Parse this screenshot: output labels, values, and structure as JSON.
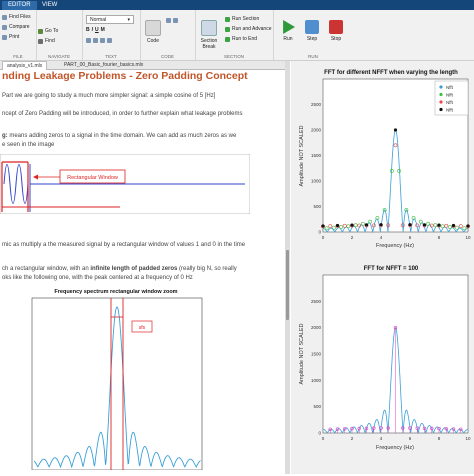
{
  "tabs": [
    "EDITOR",
    "VIEW"
  ],
  "ribbon": {
    "file_group": {
      "items": [
        "Find Files",
        "Compare",
        "Print"
      ],
      "label": "FILE"
    },
    "navigate_group": {
      "items": [
        "Go To",
        "Find"
      ],
      "label": "NAVIGATE"
    },
    "text_group": {
      "font": "Normal",
      "label": "TEXT"
    },
    "code_group": {
      "label": "CODE",
      "code_label": "Code"
    },
    "section_group": {
      "items": [
        "Section Break",
        "Run Section",
        "Run and Advance",
        "Run to End"
      ],
      "label": "SECTION"
    },
    "run_group": {
      "items": [
        "Run",
        "Step",
        "Stop"
      ],
      "label": "RUN"
    }
  },
  "doc_tabs": [
    "analysis_v1.mlx",
    "PART_00_Basic_fourier_basics.mlx"
  ],
  "document": {
    "title": "nding Leakage Problems - Zero Padding Concept",
    "lines": [
      "Part we are going to study a much more simpler signal: a simple cosine of 5 [Hz]",
      "ncept of Zero Padding will be introduced, in order to further explain what leakage problems"
    ],
    "zp_prefix": "g:",
    "zp_rest": "means adding zeros to a signal in the time domain. We can add as much zeros as we",
    "zp_line2": "e seen in the image",
    "rect_window_label": "Rectangular Window",
    "line3": "mic as multiply a the measured signal by a rectangular window of values 1 and 0 in the time",
    "line4a": "ch a rectangular window, with an ",
    "line4b": "infinite length of padded zeros",
    "line4c": " (really big N, so really",
    "line5": "oks like the following one, with the peak centered at a frequency of 0 Hz",
    "spectrum_title": "Frequency spectrum rectangular window zoom",
    "spectrum_annotation": "sfs"
  },
  "chart_data": [
    {
      "type": "line",
      "title": "FFT for different NFFT when varying the length",
      "xlabel": "Frequency (Hz)",
      "ylabel": "Amplitude NOT SCALED",
      "xlim": [
        0,
        10
      ],
      "ylim": [
        0,
        3000
      ],
      "xticks": [
        0,
        2,
        4,
        6,
        8,
        10
      ],
      "yticks": [
        0,
        500,
        1000,
        1500,
        2000,
        2500
      ],
      "legend": [
        "Nfft",
        "Nfft",
        "Nfft",
        "Nfft"
      ],
      "legend_position": "top-right",
      "series": [
        {
          "name": "Nfft",
          "peak": 2000,
          "color": "#3aa0d8"
        },
        {
          "name": "Nfft",
          "peak": 1900,
          "color": "#3cc040"
        },
        {
          "name": "Nfft",
          "peak": 1700,
          "color": "#e84a4a"
        },
        {
          "name": "Nfft",
          "peak": 2000,
          "color": "#111111"
        }
      ],
      "peak_frequency": 5
    },
    {
      "type": "line",
      "title": "FFT for NFFT = 100",
      "xlabel": "Frequency (Hz)",
      "ylabel": "Amplitude NOT SCALED",
      "xlim": [
        0,
        10
      ],
      "ylim": [
        0,
        3000
      ],
      "xticks": [
        0,
        2,
        4,
        6,
        8,
        10
      ],
      "yticks": [
        0,
        500,
        1000,
        1500,
        2000,
        2500
      ],
      "peak_frequency": 5,
      "peak": 2000,
      "series_color": "#3aa0d8",
      "marker_color": "#e040c0"
    }
  ]
}
